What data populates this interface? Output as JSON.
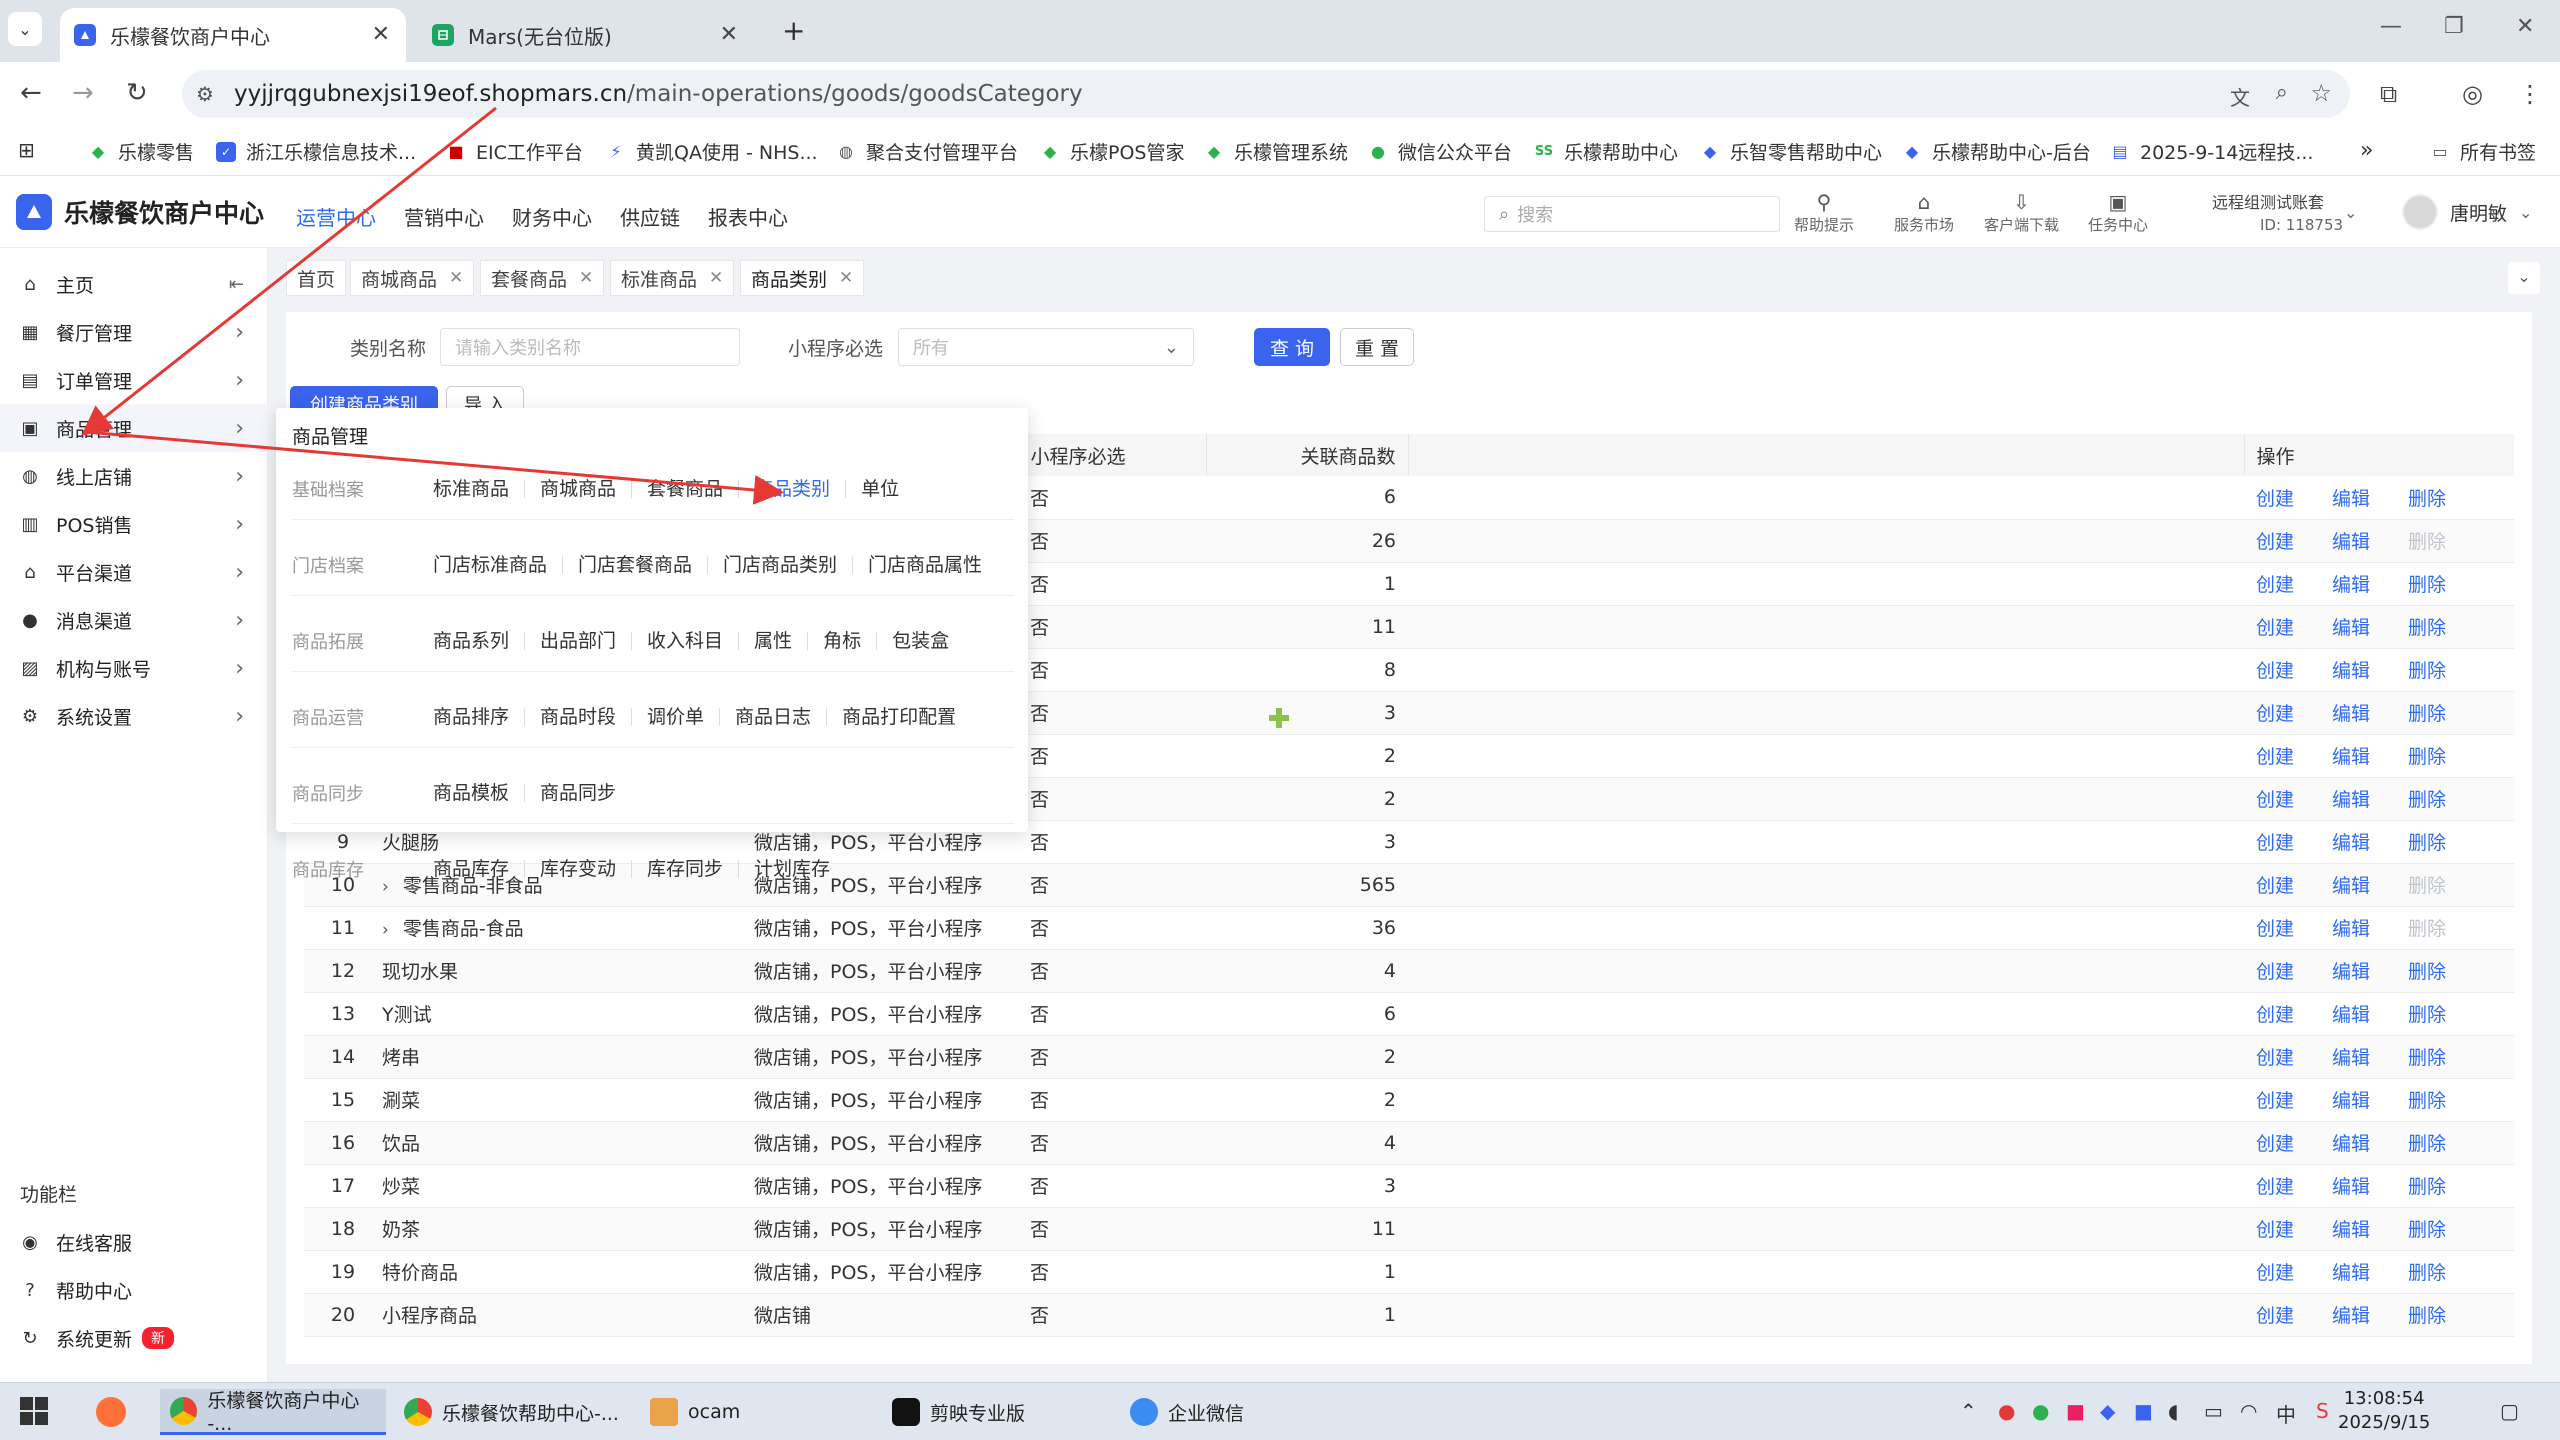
{
  "browser": {
    "tabs": [
      {
        "title": "乐檬餐饮商户中心"
      },
      {
        "title": "Mars(无台位版)"
      }
    ],
    "url_host": "yyjjrqgubnexjsi19eof.shopmars.cn",
    "url_path": "/main-operations/goods/goodsCategory",
    "bookmarks": [
      "乐檬零售",
      "浙江乐檬信息技术...",
      "EIC工作平台",
      "黄凯QA使用 - NHS...",
      "聚合支付管理平台",
      "乐檬POS管家",
      "乐檬管理系统",
      "微信公众平台",
      "乐檬帮助中心",
      "乐智零售帮助中心",
      "乐檬帮助中心-后台",
      "2025-9-14远程技...",
      "所有书签"
    ]
  },
  "app": {
    "name": "乐檬餐饮商户中心",
    "topnav": [
      "运营中心",
      "营销中心",
      "财务中心",
      "供应链",
      "报表中心"
    ],
    "search_placeholder": "搜索",
    "tools": [
      "帮助提示",
      "服务市场",
      "客户端下载",
      "任务中心"
    ],
    "account_name": "远程组测试账套",
    "account_id": "ID: 118753",
    "user": "唐明敏"
  },
  "sidebar": {
    "items": [
      "主页",
      "餐厅管理",
      "订单管理",
      "商品管理",
      "线上店铺",
      "POS销售",
      "平台渠道",
      "消息渠道",
      "机构与账号",
      "系统设置"
    ],
    "func_label": "功能栏",
    "func_items": [
      "在线客服",
      "帮助中心",
      "系统更新"
    ],
    "new_badge": "新"
  },
  "page_tabs": [
    "首页",
    "商城商品",
    "套餐商品",
    "标准商品",
    "商品类别"
  ],
  "filter": {
    "category_label": "类别名称",
    "category_placeholder": "请输入类别名称",
    "mini_label": "小程序必选",
    "mini_value": "所有",
    "query_btn": "查 询",
    "reset_btn": "重 置",
    "create_btn": "创建商品类别",
    "import_btn": "导 入"
  },
  "table": {
    "headers": [
      "小程序必选",
      "关联商品数",
      "操作"
    ],
    "ops": [
      "创建",
      "编辑",
      "删除"
    ],
    "rows": [
      {
        "idx": "",
        "name": "",
        "channel": "",
        "mini": "否",
        "count": "6",
        "del_disabled": false,
        "expand": false
      },
      {
        "idx": "",
        "name": "",
        "channel": "",
        "mini": "否",
        "count": "26",
        "del_disabled": true,
        "expand": false
      },
      {
        "idx": "",
        "name": "",
        "channel": "",
        "mini": "否",
        "count": "1",
        "del_disabled": false,
        "expand": false
      },
      {
        "idx": "",
        "name": "",
        "channel": "",
        "mini": "否",
        "count": "11",
        "del_disabled": false,
        "expand": false
      },
      {
        "idx": "",
        "name": "",
        "channel": "",
        "mini": "否",
        "count": "8",
        "del_disabled": false,
        "expand": false
      },
      {
        "idx": "",
        "name": "",
        "channel": "",
        "mini": "否",
        "count": "3",
        "del_disabled": false,
        "expand": false
      },
      {
        "idx": "",
        "name": "",
        "channel": "",
        "mini": "否",
        "count": "2",
        "del_disabled": false,
        "expand": false
      },
      {
        "idx": "",
        "name": "",
        "channel": "",
        "mini": "否",
        "count": "2",
        "del_disabled": false,
        "expand": false
      },
      {
        "idx": "9",
        "name": "火腿肠",
        "channel": "微店铺，POS，平台小程序",
        "mini": "否",
        "count": "3",
        "del_disabled": false,
        "expand": false
      },
      {
        "idx": "10",
        "name": "零售商品-非食品",
        "channel": "微店铺，POS，平台小程序",
        "mini": "否",
        "count": "565",
        "del_disabled": true,
        "expand": true
      },
      {
        "idx": "11",
        "name": "零售商品-食品",
        "channel": "微店铺，POS，平台小程序",
        "mini": "否",
        "count": "36",
        "del_disabled": true,
        "expand": true
      },
      {
        "idx": "12",
        "name": "现切水果",
        "channel": "微店铺，POS，平台小程序",
        "mini": "否",
        "count": "4",
        "del_disabled": false,
        "expand": false
      },
      {
        "idx": "13",
        "name": "Y测试",
        "channel": "微店铺，POS，平台小程序",
        "mini": "否",
        "count": "6",
        "del_disabled": false,
        "expand": false
      },
      {
        "idx": "14",
        "name": "烤串",
        "channel": "微店铺，POS，平台小程序",
        "mini": "否",
        "count": "2",
        "del_disabled": false,
        "expand": false
      },
      {
        "idx": "15",
        "name": "涮菜",
        "channel": "微店铺，POS，平台小程序",
        "mini": "否",
        "count": "2",
        "del_disabled": false,
        "expand": false
      },
      {
        "idx": "16",
        "name": "饮品",
        "channel": "微店铺，POS，平台小程序",
        "mini": "否",
        "count": "4",
        "del_disabled": false,
        "expand": false
      },
      {
        "idx": "17",
        "name": "炒菜",
        "channel": "微店铺，POS，平台小程序",
        "mini": "否",
        "count": "3",
        "del_disabled": false,
        "expand": false
      },
      {
        "idx": "18",
        "name": "奶茶",
        "channel": "微店铺，POS，平台小程序",
        "mini": "否",
        "count": "11",
        "del_disabled": false,
        "expand": false
      },
      {
        "idx": "19",
        "name": "特价商品",
        "channel": "微店铺，POS，平台小程序",
        "mini": "否",
        "count": "1",
        "del_disabled": false,
        "expand": false
      },
      {
        "idx": "20",
        "name": "小程序商品",
        "channel": "微店铺",
        "mini": "否",
        "count": "1",
        "del_disabled": false,
        "expand": false
      }
    ]
  },
  "menu": {
    "title": "商品管理",
    "selected": "商品类别",
    "groups": [
      {
        "label": "基础档案",
        "items": [
          "标准商品",
          "商城商品",
          "套餐商品",
          "商品类别",
          "单位"
        ]
      },
      {
        "label": "门店档案",
        "items": [
          "门店标准商品",
          "门店套餐商品",
          "门店商品类别",
          "门店商品属性"
        ]
      },
      {
        "label": "商品拓展",
        "items": [
          "商品系列",
          "出品部门",
          "收入科目",
          "属性",
          "角标",
          "包装盒"
        ]
      },
      {
        "label": "商品运营",
        "items": [
          "商品排序",
          "商品时段",
          "调价单",
          "商品日志",
          "商品打印配置"
        ]
      },
      {
        "label": "商品同步",
        "items": [
          "商品模板",
          "商品同步"
        ]
      },
      {
        "label": "商品库存",
        "items": [
          "商品库存",
          "库存变动",
          "库存同步",
          "计划库存"
        ]
      }
    ]
  },
  "taskbar": {
    "apps": [
      "乐檬餐饮商户中心 -...",
      "乐檬餐饮帮助中心-...",
      "ocam",
      "剪映专业版",
      "企业微信"
    ],
    "ime": "中",
    "time": "13:08:54",
    "date": "2025/9/15"
  },
  "colors": {
    "accent": "#2d6cf0",
    "annotation": "#e53935",
    "primary_btn": "#3a63ee"
  }
}
